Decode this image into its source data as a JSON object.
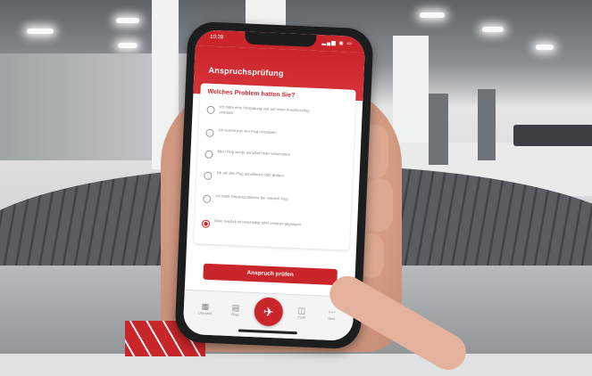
{
  "status_bar": {
    "time": "10:28",
    "signal": "▂▄▆ ◉ ▭"
  },
  "app": {
    "title": "Anspruchsprüfung",
    "question": "Welches Problem hatten Sie?",
    "options": [
      {
        "text": "Ich hatte eine Verspätung und auf einen Anschlussflug verpasst",
        "selected": false
      },
      {
        "text": "Ich konnte mei nen Flug verpassen",
        "selected": false
      },
      {
        "text": "Mein Flug wurde annulliert oder verschoben",
        "selected": false
      },
      {
        "text": "Ich will den Flug annullieren oder ändern",
        "selected": false
      },
      {
        "text": "Ich hatte Gepäckprobleme bei meinem Flug",
        "selected": false
      },
      {
        "text": "Mein Gepäck ist beschädigt oder verloren gegangen",
        "selected": true
      }
    ],
    "cta_label": "Anspruch prüfen",
    "tabs": [
      {
        "icon": "▦",
        "label": "Übersicht"
      },
      {
        "icon": "▤",
        "label": "Flüge"
      },
      {
        "icon": "✈",
        "label": ""
      },
      {
        "icon": "◫",
        "label": "Profil"
      },
      {
        "icon": "⋯",
        "label": "Mehr"
      }
    ],
    "accent_color": "#c9252b"
  }
}
